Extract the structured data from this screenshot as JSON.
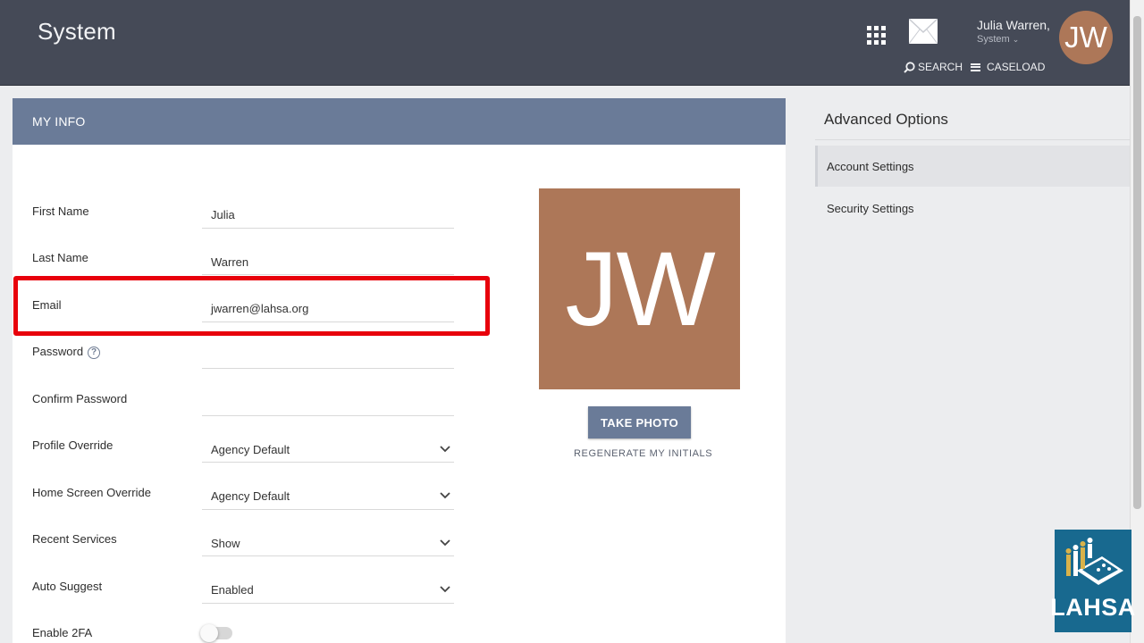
{
  "header": {
    "app_title": "System",
    "user_name": "Julia Warren,",
    "user_role": "System",
    "avatar_initials": "JW",
    "search_label": "SEARCH",
    "caseload_label": "CASELOAD"
  },
  "panel": {
    "title": "MY INFO"
  },
  "form": {
    "first_name": {
      "label": "First Name",
      "value": "Julia"
    },
    "last_name": {
      "label": "Last Name",
      "value": "Warren"
    },
    "email": {
      "label": "Email",
      "value": "jwarren@lahsa.org"
    },
    "password": {
      "label": "Password",
      "value": ""
    },
    "confirm_password": {
      "label": "Confirm Password",
      "value": ""
    },
    "profile_override": {
      "label": "Profile Override",
      "value": "Agency Default"
    },
    "home_screen_override": {
      "label": "Home Screen Override",
      "value": "Agency Default"
    },
    "recent_services": {
      "label": "Recent Services",
      "value": "Show"
    },
    "auto_suggest": {
      "label": "Auto Suggest",
      "value": "Enabled"
    },
    "enable_2fa": {
      "label": "Enable 2FA",
      "enabled": false
    }
  },
  "photo": {
    "initials": "JW",
    "take_photo_label": "TAKE PHOTO",
    "regenerate_label": "REGENERATE MY INITIALS"
  },
  "sidebar": {
    "title": "Advanced Options",
    "items": [
      {
        "label": "Account Settings",
        "active": true
      },
      {
        "label": "Security Settings",
        "active": false
      }
    ]
  },
  "logo": {
    "text": "LAHSA"
  },
  "colors": {
    "header_bg": "#454a57",
    "panel_header": "#6a7b98",
    "avatar": "#ad7758",
    "highlight": "#e8000b",
    "logo_bg": "#18698f"
  }
}
